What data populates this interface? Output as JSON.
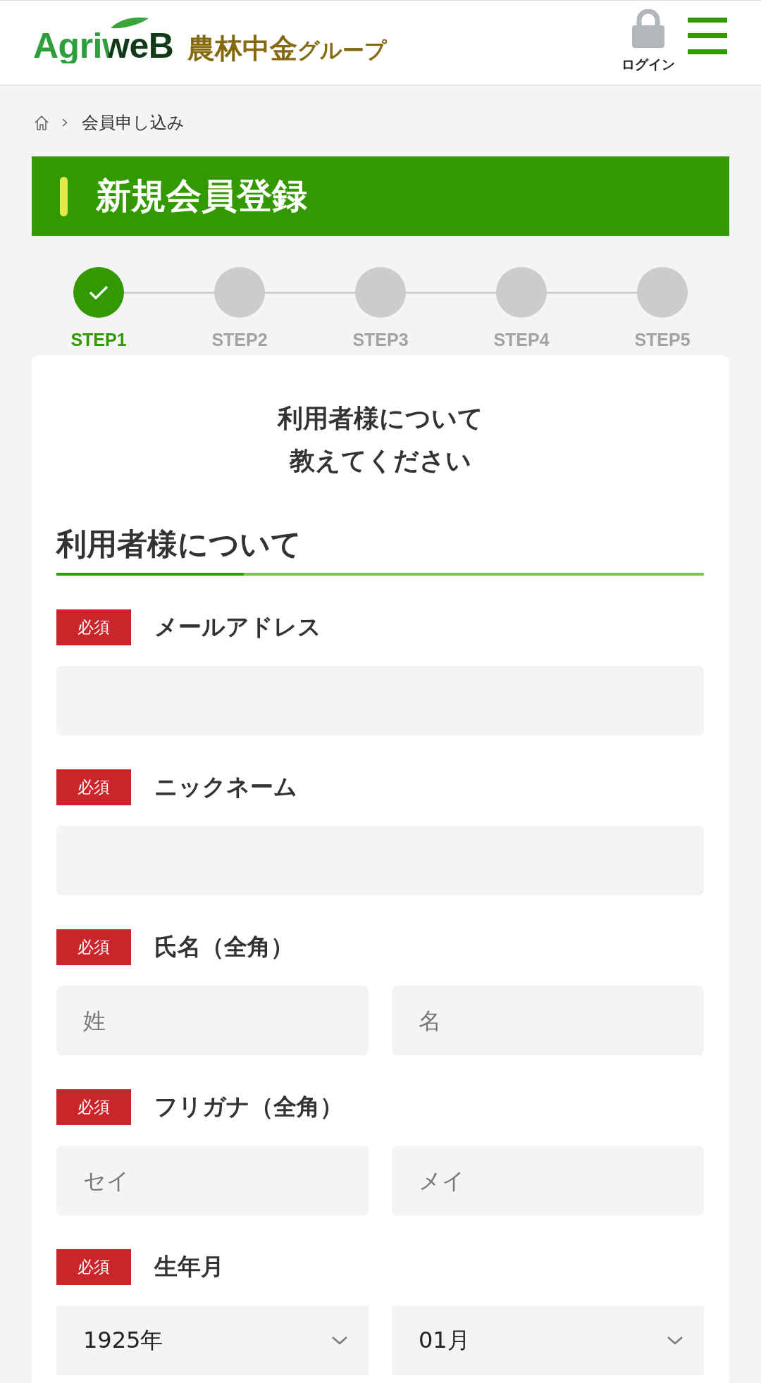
{
  "header": {
    "logo": {
      "wordmark": "AgriweB",
      "group_name": "農林中金",
      "group_suffix": "グループ"
    },
    "login": {
      "label": "ログイン"
    }
  },
  "breadcrumb": {
    "items": [
      {
        "label": "会員申し込み"
      }
    ]
  },
  "page_title": "新規会員登録",
  "steps": [
    {
      "label": "STEP1",
      "completed": true
    },
    {
      "label": "STEP2",
      "completed": false
    },
    {
      "label": "STEP3",
      "completed": false
    },
    {
      "label": "STEP4",
      "completed": false
    },
    {
      "label": "STEP5",
      "completed": false
    }
  ],
  "form": {
    "intro_lines": [
      "利用者様について",
      "教えてください"
    ],
    "section_title": "利用者様について",
    "fields": [
      {
        "kind": "text",
        "tag": "必須",
        "label": "メールアドレス"
      },
      {
        "kind": "text",
        "tag": "必須",
        "label": "ニックネーム"
      },
      {
        "kind": "pair",
        "tag": "必須",
        "label": "氏名（全角）",
        "placeholders": [
          "姓",
          "名"
        ]
      },
      {
        "kind": "pair",
        "tag": "必須",
        "label": "フリガナ（全角）",
        "placeholders": [
          "セイ",
          "メイ"
        ]
      },
      {
        "kind": "select",
        "tag": "必須",
        "label": "生年月",
        "values": [
          "1925年",
          "01月"
        ]
      }
    ]
  }
}
